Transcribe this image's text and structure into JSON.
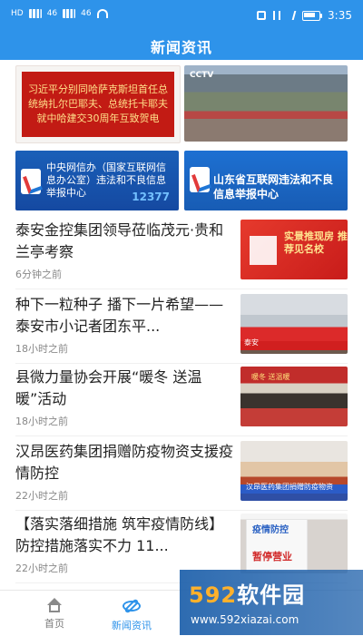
{
  "status_bar": {
    "time": "3:35",
    "left_texts": [
      "HD",
      "46",
      "46"
    ]
  },
  "app_bar": {
    "title": "新闻资讯"
  },
  "banners": [
    {
      "text": "习近平分别同哈萨克斯坦首任总统纳扎尔巴耶夫、总统托卡耶夫就中哈建交30周年互致贺电"
    },
    {
      "text": "CCTV"
    },
    {
      "text": "中央网信办（国家互联网信息办公室）违法和不良信息举报中心",
      "number": "12377"
    },
    {
      "text": "山东省互联网违法和不良信息举报中心"
    }
  ],
  "news": [
    {
      "title": "泰安金控集团领导莅临茂元·贵和兰亭考察",
      "time": "6分钟之前",
      "thumb_text": "实景推现房 推荐见名校"
    },
    {
      "title": "种下一粒种子 播下一片希望——泰安市小记者团东平...",
      "time": "18小时之前",
      "thumb_text": "泰安"
    },
    {
      "title": "县微力量协会开展“暖冬 送温暖”活动",
      "time": "18小时之前",
      "thumb_text": "暖冬 送温暖"
    },
    {
      "title": "汉昂医药集团捐赠防疫物资支援疫情防控",
      "time": "22小时之前",
      "thumb_text": "汉昂医药集团捐赠防疫物资"
    },
    {
      "title": "【落实落细措施 筑牢疫情防线】 防控措施落实不力 11...",
      "time": "22小时之前",
      "thumb_text_1": "疫情防控",
      "thumb_text_2": "暂停营业"
    }
  ],
  "bottom_nav": [
    {
      "label": "首页",
      "icon": "home-icon"
    },
    {
      "label": "新闻资讯",
      "icon": "news-icon"
    }
  ],
  "watermark": {
    "brand_num": "592",
    "brand_text": "软件园",
    "url": "www.592xiazai.com"
  }
}
